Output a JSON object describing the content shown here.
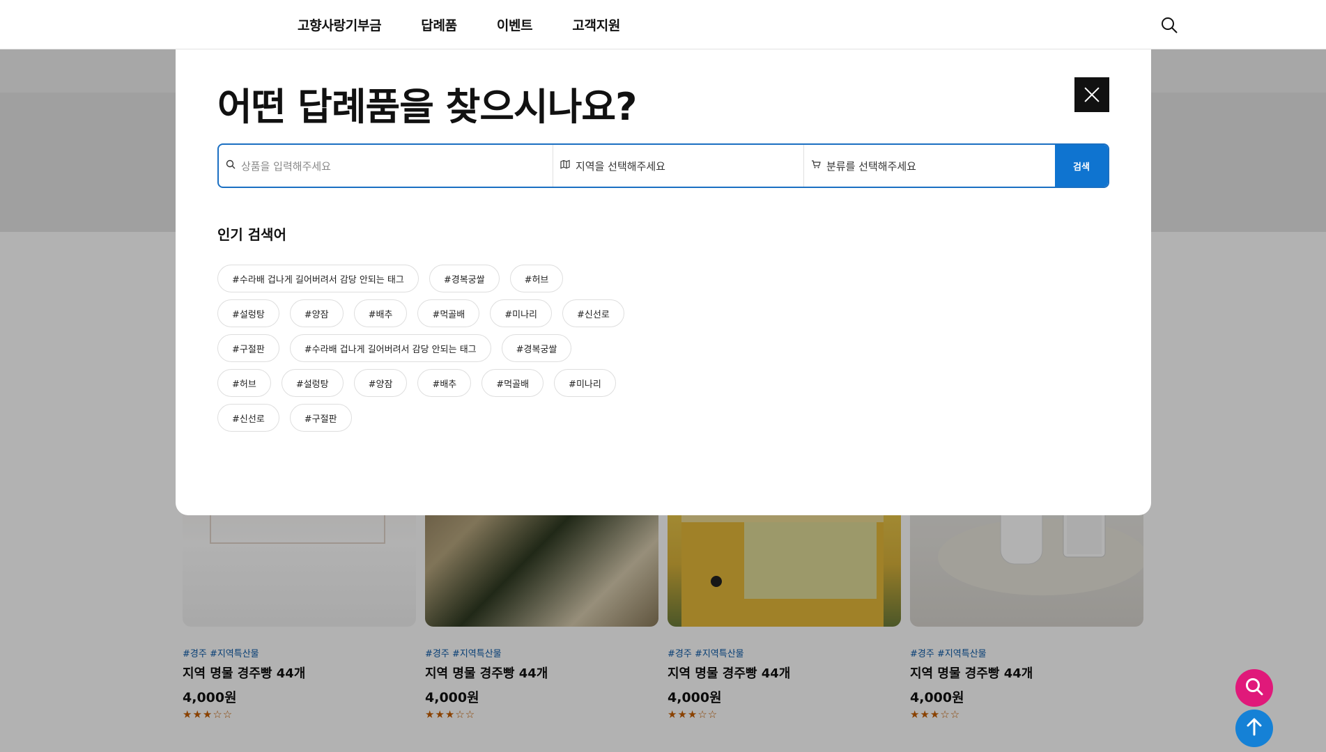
{
  "header": {
    "nav": [
      "고향사랑기부금",
      "답례품",
      "이벤트",
      "고객지원"
    ],
    "search_icon": "search-icon"
  },
  "modal": {
    "title": "어떤 답례품을 찾으시나요?",
    "close_icon": "close-icon",
    "search": {
      "product_placeholder": "상품을 입력해주세요",
      "region_label": "지역을 선택해주세요",
      "category_label": "분류를 선택해주세요",
      "submit_label": "검색"
    },
    "popular_title": "인기 검색어",
    "tag_rows": [
      [
        "#수라배 겁나게 길어버려서 감당 안되는 태그",
        "#경복궁쌀",
        "#허브"
      ],
      [
        "#설렁탕",
        "#양잠",
        "#배추",
        "#먹골배",
        "#미나리",
        "#신선로"
      ],
      [
        "#구절판",
        "#수라배 겁나게 길어버려서 감당 안되는 태그",
        "#경복궁쌀"
      ],
      [
        "#허브",
        "#설렁탕",
        "#양잠",
        "#배추",
        "#먹골배",
        "#미나리"
      ],
      [
        "#신선로",
        "#구절판"
      ]
    ]
  },
  "products": [
    {
      "tags": "#경주 #지역특산물",
      "name": "지역 명물 경주빵 44개",
      "price": "4,000원",
      "stars": "★★★☆☆"
    },
    {
      "tags": "#경주 #지역특산물",
      "name": "지역 명물 경주빵 44개",
      "price": "4,000원",
      "stars": "★★★☆☆"
    },
    {
      "tags": "#경주 #지역특산물",
      "name": "지역 명물 경주빵 44개",
      "price": "4,000원",
      "stars": "★★★☆☆"
    },
    {
      "tags": "#경주 #지역특산물",
      "name": "지역 명물 경주빵 44개",
      "price": "4,000원",
      "stars": "★★★☆☆"
    }
  ],
  "colors": {
    "accent_blue": "#0f74d0",
    "fab_pink": "#e0197a",
    "fab_blue": "#1581d6",
    "tag_blue": "#0b5aa8",
    "star_orange": "#c55e00"
  }
}
